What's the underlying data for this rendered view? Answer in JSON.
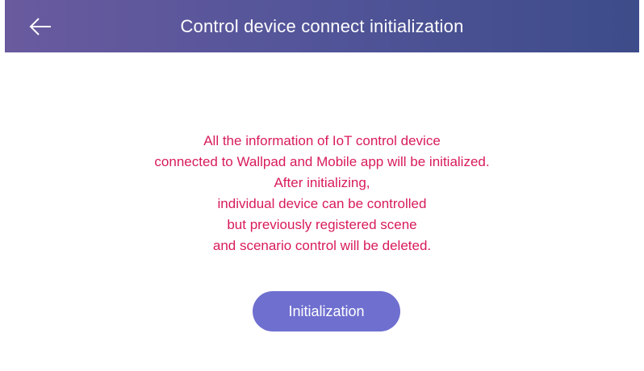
{
  "header": {
    "title": "Control device connect initialization",
    "back_icon": "back-arrow-icon"
  },
  "message": {
    "lines": [
      "All the information of IoT control device",
      "connected to Wallpad and Mobile app will be initialized.",
      "After initializing,",
      "individual device can be controlled",
      "but previously registered scene",
      "and scenario control will be deleted."
    ],
    "color": "#d81b5a"
  },
  "actions": {
    "initialization_label": "Initialization",
    "button_color": "#6f6fd0"
  },
  "colors": {
    "header_gradient_start": "#6a5a9e",
    "header_gradient_end": "#3d4c8a"
  }
}
